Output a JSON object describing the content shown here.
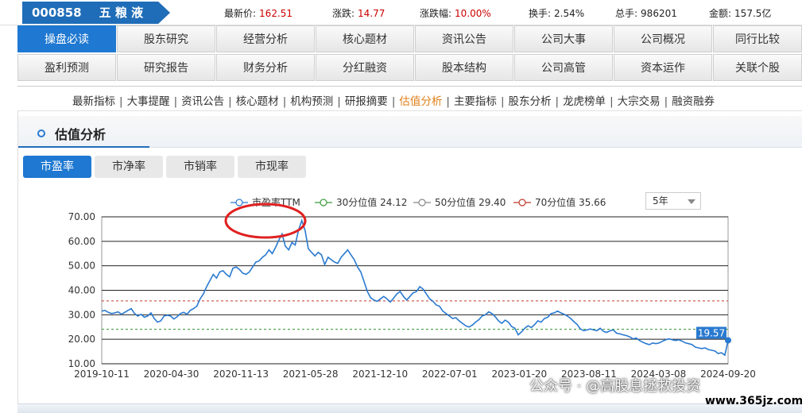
{
  "stock": {
    "code": "000858",
    "name": "五 粮 液"
  },
  "quote": [
    {
      "label": "最新价:",
      "value": "162.51",
      "red": true
    },
    {
      "label": "涨跌:",
      "value": "14.77",
      "red": true
    },
    {
      "label": "涨跌幅:",
      "value": "10.00%",
      "red": true
    },
    {
      "label": "换手:",
      "value": "2.54%",
      "red": false
    },
    {
      "label": "总手:",
      "value": "986201",
      "red": false
    },
    {
      "label": "金额:",
      "value": "157.5亿",
      "red": false
    }
  ],
  "nav": {
    "row1": [
      "操盘必读",
      "股东研究",
      "经营分析",
      "核心题材",
      "资讯公告",
      "公司大事",
      "公司概况",
      "同行比较"
    ],
    "row2": [
      "盈利预测",
      "研究报告",
      "财务分析",
      "分红融资",
      "股本结构",
      "公司高管",
      "资本运作",
      "关联个股"
    ]
  },
  "subnav": [
    "最新指标",
    "大事提醒",
    "资讯公告",
    "核心题材",
    "机构预测",
    "研报摘要",
    "估值分析",
    "主要指标",
    "股东分析",
    "龙虎榜单",
    "大宗交易",
    "融资融券"
  ],
  "subnav_selected": "估值分析",
  "panel": {
    "title": "估值分析"
  },
  "tabs": [
    "市盈率",
    "市净率",
    "市销率",
    "市现率"
  ],
  "period_select": "5年",
  "watermark": "公众号 · @高股息拯救投资",
  "watermark_site": "www.365jz.com",
  "colors": {
    "accent": "#1f78d1",
    "series": "#2a7ad0",
    "p30": "#3a9a3a",
    "p50": "#888888",
    "p70": "#c0392b",
    "highlight": "#e02020"
  },
  "chart_data": {
    "type": "line",
    "legend": [
      {
        "name": "市盈率TTM",
        "color": "#2a7ad0"
      },
      {
        "name": "30分位值 24.12",
        "color": "#3a9a3a"
      },
      {
        "name": "50分位值 29.40",
        "color": "#888888"
      },
      {
        "name": "70分位值 35.66",
        "color": "#c0392b"
      }
    ],
    "yticks": [
      "70.00",
      "60.00",
      "50.00",
      "40.00",
      "30.00",
      "20.00",
      "10.00"
    ],
    "ylim": [
      10,
      70
    ],
    "xticks": [
      "2019-10-11",
      "2020-04-30",
      "2020-11-13",
      "2021-05-28",
      "2021-12-10",
      "2022-07-01",
      "2023-01-20",
      "2023-08-11",
      "2024-03-08",
      "2024-09-20"
    ],
    "reference_lines": [
      {
        "name": "30分位值",
        "value": 24.12,
        "color": "#3a9a3a"
      },
      {
        "name": "50分位值",
        "value": 29.4,
        "color": "#888888"
      },
      {
        "name": "70分位值",
        "value": 35.66,
        "color": "#c0392b"
      }
    ],
    "last_value_label": "19.57",
    "series": [
      {
        "name": "市盈率TTM",
        "values": [
          31.5,
          31.8,
          31,
          30.5,
          30.8,
          31.2,
          30.2,
          31,
          31.8,
          32.5,
          30.5,
          29.5,
          30.2,
          29,
          29.5,
          30.8,
          28.5,
          27,
          27.5,
          29.5,
          29.8,
          29.5,
          28.3,
          29.2,
          30.5,
          31,
          30.2,
          31.8,
          32.5,
          33.5,
          36.5,
          38.5,
          41.5,
          44,
          46.5,
          45,
          47.5,
          48,
          46.5,
          45.5,
          49,
          49.5,
          48.5,
          47,
          46.5,
          47.5,
          49.5,
          51.5,
          52,
          53.5,
          54.5,
          56.5,
          55,
          57.5,
          60.5,
          63,
          58,
          56.5,
          59.5,
          58.5,
          64.5,
          68.5,
          64.5,
          57,
          55.5,
          54,
          55.5,
          54.5,
          50.5,
          53.5,
          52.5,
          51.5,
          51,
          53.5,
          55,
          56.5,
          54.5,
          52.5,
          49.5,
          47.5,
          43.5,
          39.5,
          37,
          36,
          35.5,
          36.5,
          37.5,
          36.5,
          35.2,
          36.8,
          38.5,
          39.5,
          37.5,
          36,
          37.5,
          39,
          39.5,
          41.5,
          40.5,
          38.5,
          36.5,
          35.5,
          34,
          33.5,
          31.5,
          30.5,
          29.5,
          28.5,
          28.8,
          27.5,
          26.5,
          25.5,
          25,
          25.8,
          27,
          28,
          29.5,
          30,
          31.2,
          30.5,
          29.2,
          27.5,
          26.5,
          27.8,
          27,
          25.2,
          24.5,
          21.8,
          23,
          24.5,
          25.5,
          24.8,
          26,
          27.5,
          27,
          28.5,
          29,
          30.5,
          30.8,
          31.5,
          30.8,
          30.2,
          29.5,
          28.5,
          27.2,
          26,
          24.2,
          23.5,
          23.8,
          24.2,
          23.8,
          23.5,
          24.5,
          23.2,
          22.8,
          23.5,
          23.8,
          22.5,
          22.2,
          21.8,
          21.5,
          21,
          20.2,
          20.5,
          19.5,
          18.8,
          18.2,
          17.8,
          18.5,
          18.2,
          18.5,
          19.2,
          19.8,
          20.2,
          19.8,
          19.5,
          19.8,
          19.2,
          18.5,
          18.2,
          17.8,
          16.8,
          16.5,
          16.2,
          16.5,
          15.8,
          15.5,
          15.2,
          14.2,
          14.5,
          13.5,
          19.57
        ]
      }
    ]
  }
}
